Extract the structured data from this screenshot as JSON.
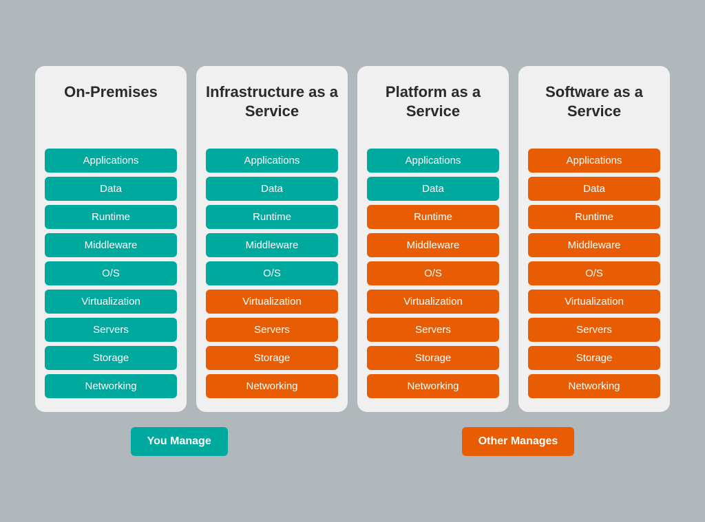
{
  "columns": [
    {
      "id": "on-premises",
      "title": "On-Premises",
      "items": [
        {
          "label": "Applications",
          "color": "teal"
        },
        {
          "label": "Data",
          "color": "teal"
        },
        {
          "label": "Runtime",
          "color": "teal"
        },
        {
          "label": "Middleware",
          "color": "teal"
        },
        {
          "label": "O/S",
          "color": "teal"
        },
        {
          "label": "Virtualization",
          "color": "teal"
        },
        {
          "label": "Servers",
          "color": "teal"
        },
        {
          "label": "Storage",
          "color": "teal"
        },
        {
          "label": "Networking",
          "color": "teal"
        }
      ]
    },
    {
      "id": "iaas",
      "title": "Infrastructure as a Service",
      "items": [
        {
          "label": "Applications",
          "color": "teal"
        },
        {
          "label": "Data",
          "color": "teal"
        },
        {
          "label": "Runtime",
          "color": "teal"
        },
        {
          "label": "Middleware",
          "color": "teal"
        },
        {
          "label": "O/S",
          "color": "teal"
        },
        {
          "label": "Virtualization",
          "color": "orange"
        },
        {
          "label": "Servers",
          "color": "orange"
        },
        {
          "label": "Storage",
          "color": "orange"
        },
        {
          "label": "Networking",
          "color": "orange"
        }
      ]
    },
    {
      "id": "paas",
      "title": "Platform as a Service",
      "items": [
        {
          "label": "Applications",
          "color": "teal"
        },
        {
          "label": "Data",
          "color": "teal"
        },
        {
          "label": "Runtime",
          "color": "orange"
        },
        {
          "label": "Middleware",
          "color": "orange"
        },
        {
          "label": "O/S",
          "color": "orange"
        },
        {
          "label": "Virtualization",
          "color": "orange"
        },
        {
          "label": "Servers",
          "color": "orange"
        },
        {
          "label": "Storage",
          "color": "orange"
        },
        {
          "label": "Networking",
          "color": "orange"
        }
      ]
    },
    {
      "id": "saas",
      "title": "Software as a Service",
      "items": [
        {
          "label": "Applications",
          "color": "orange"
        },
        {
          "label": "Data",
          "color": "orange"
        },
        {
          "label": "Runtime",
          "color": "orange"
        },
        {
          "label": "Middleware",
          "color": "orange"
        },
        {
          "label": "O/S",
          "color": "orange"
        },
        {
          "label": "Virtualization",
          "color": "orange"
        },
        {
          "label": "Servers",
          "color": "orange"
        },
        {
          "label": "Storage",
          "color": "orange"
        },
        {
          "label": "Networking",
          "color": "orange"
        }
      ]
    }
  ],
  "legend": {
    "you_manage_label": "You Manage",
    "other_manages_label": "Other Manages"
  }
}
